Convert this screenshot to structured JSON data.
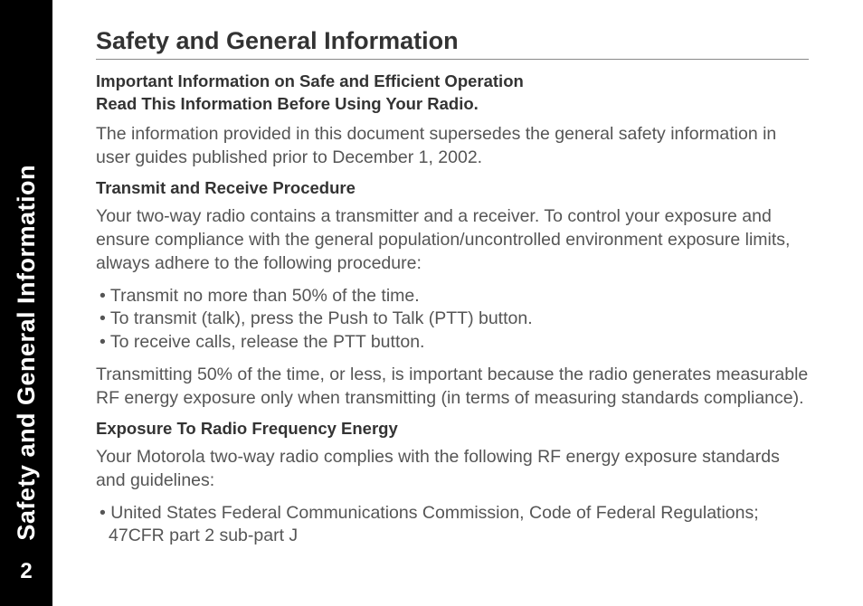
{
  "sidebar": {
    "title": "Safety and General Information",
    "pageNumber": "2"
  },
  "content": {
    "heading": "Safety and General Information",
    "importantLine1": "Important Information on Safe and Efficient Operation",
    "importantLine2": "Read This Information Before Using Your Radio.",
    "intro": "The information provided in this document supersedes the general safety information in user guides published prior to December 1, 2002.",
    "section1": {
      "title": "Transmit and Receive Procedure",
      "body1": "Your two-way radio contains a transmitter and a receiver. To control your exposure and ensure compliance with the general population/uncontrolled environment exposure limits, always adhere to the following procedure:",
      "bullets": [
        "Transmit no more than 50% of the time.",
        "To transmit (talk), press the Push to Talk (PTT) button.",
        "To receive calls, release the PTT button."
      ],
      "body2": "Transmitting 50% of the time, or less, is important because the radio generates measurable RF energy exposure only when transmitting (in terms of measuring standards compliance)."
    },
    "section2": {
      "title": "Exposure To Radio Frequency Energy",
      "body1": "Your Motorola two-way radio complies with the following RF energy exposure standards and guidelines:",
      "bullets": [
        "United States Federal Communications Commission, Code of Federal Regulations; 47CFR part 2 sub-part J"
      ]
    }
  }
}
